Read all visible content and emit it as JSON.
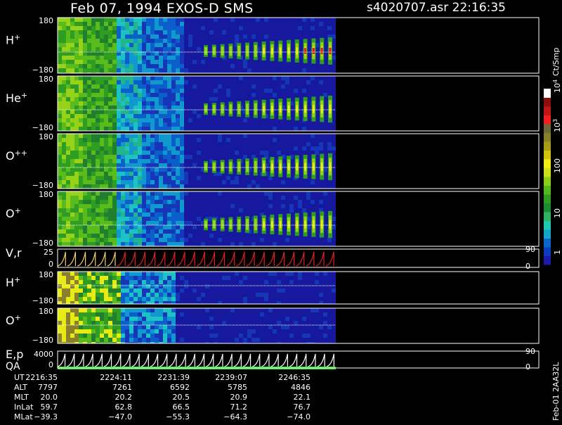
{
  "header": {
    "title": "Feb 07, 1994   EXOS-D SMS",
    "file": "s4020707.asr  22:16:35"
  },
  "chart_data": {
    "type": "heatmap",
    "x_label": "UT",
    "y_range": [
      -180,
      180
    ],
    "panels": [
      {
        "key": "h",
        "label_base": "H",
        "label_sup": "+",
        "ymax_label": "180",
        "ymin_label": "−180",
        "kind": "h"
      },
      {
        "key": "he",
        "label_base": "He",
        "label_sup": "+",
        "ymax_label": "180",
        "ymin_label": "−180",
        "kind": "he"
      },
      {
        "key": "opp",
        "label_base": "O",
        "label_sup": "++",
        "ymax_label": "180",
        "ymin_label": "−180",
        "kind": "opp"
      },
      {
        "key": "op",
        "label_base": "O",
        "label_sup": "+",
        "ymax_label": "180",
        "ymin_label": "−180",
        "kind": "op"
      },
      {
        "key": "vr",
        "label_base": "V,r",
        "label_sup": "",
        "ymax_label": "25",
        "ymin_label": "0",
        "kind": "line",
        "right_top": "90",
        "right_bottom": "0"
      },
      {
        "key": "h2",
        "label_base": "H",
        "label_sup": "+",
        "ymax_label": "180",
        "ymin_label": "−180",
        "kind": "h2"
      },
      {
        "key": "o2",
        "label_base": "O",
        "label_sup": "+",
        "ymax_label": "180",
        "ymin_label": "−180",
        "kind": "o2"
      },
      {
        "key": "ep",
        "label_base": "E,p",
        "label_sup": "",
        "label2": "QA",
        "ymax_label": "4000",
        "ymin_label": "0",
        "kind": "line2",
        "right_top": "90",
        "right_bottom": "0"
      }
    ],
    "colorbar": {
      "unit": "Ct/Smp",
      "ticks": [
        {
          "label": "1",
          "sup": ""
        },
        {
          "label": "10",
          "sup": ""
        },
        {
          "label": "100",
          "sup": ""
        },
        {
          "label": "10",
          "sup": "3"
        },
        {
          "label": "10",
          "sup": "4"
        }
      ],
      "colors": [
        "#1a1aa8",
        "#0b3cc0",
        "#0a66cc",
        "#13a5c8",
        "#1cc8b0",
        "#33b060",
        "#1e8a32",
        "#2f9c22",
        "#55b81c",
        "#8ccf1a",
        "#cbe21c",
        "#f2ee14",
        "#cfc110",
        "#a89c1a",
        "#8a7f2a",
        "#6f6a3a",
        "#f21e1e",
        "#bf1616",
        "#8e0e0e",
        "#ffffff"
      ]
    },
    "ephemeris": {
      "rows": [
        {
          "label": "UT",
          "values": [
            "2216:35",
            "2224:11",
            "2231:39",
            "2239:07",
            "2246:35"
          ]
        },
        {
          "label": "ALT",
          "values": [
            "7797",
            "7261",
            "6592",
            "5785",
            "4846"
          ]
        },
        {
          "label": "MLT",
          "values": [
            "20.0",
            "20.2",
            "20.5",
            "20.9",
            "22.1"
          ]
        },
        {
          "label": "InLat",
          "values": [
            "59.7",
            "62.8",
            "66.5",
            "71.2",
            "76.7"
          ]
        },
        {
          "label": "MLat",
          "values": [
            "−39.3",
            "−47.0",
            "−55.3",
            "−64.3",
            "−74.0"
          ]
        }
      ]
    },
    "footer_id": "Feb-01 2AA32L"
  }
}
